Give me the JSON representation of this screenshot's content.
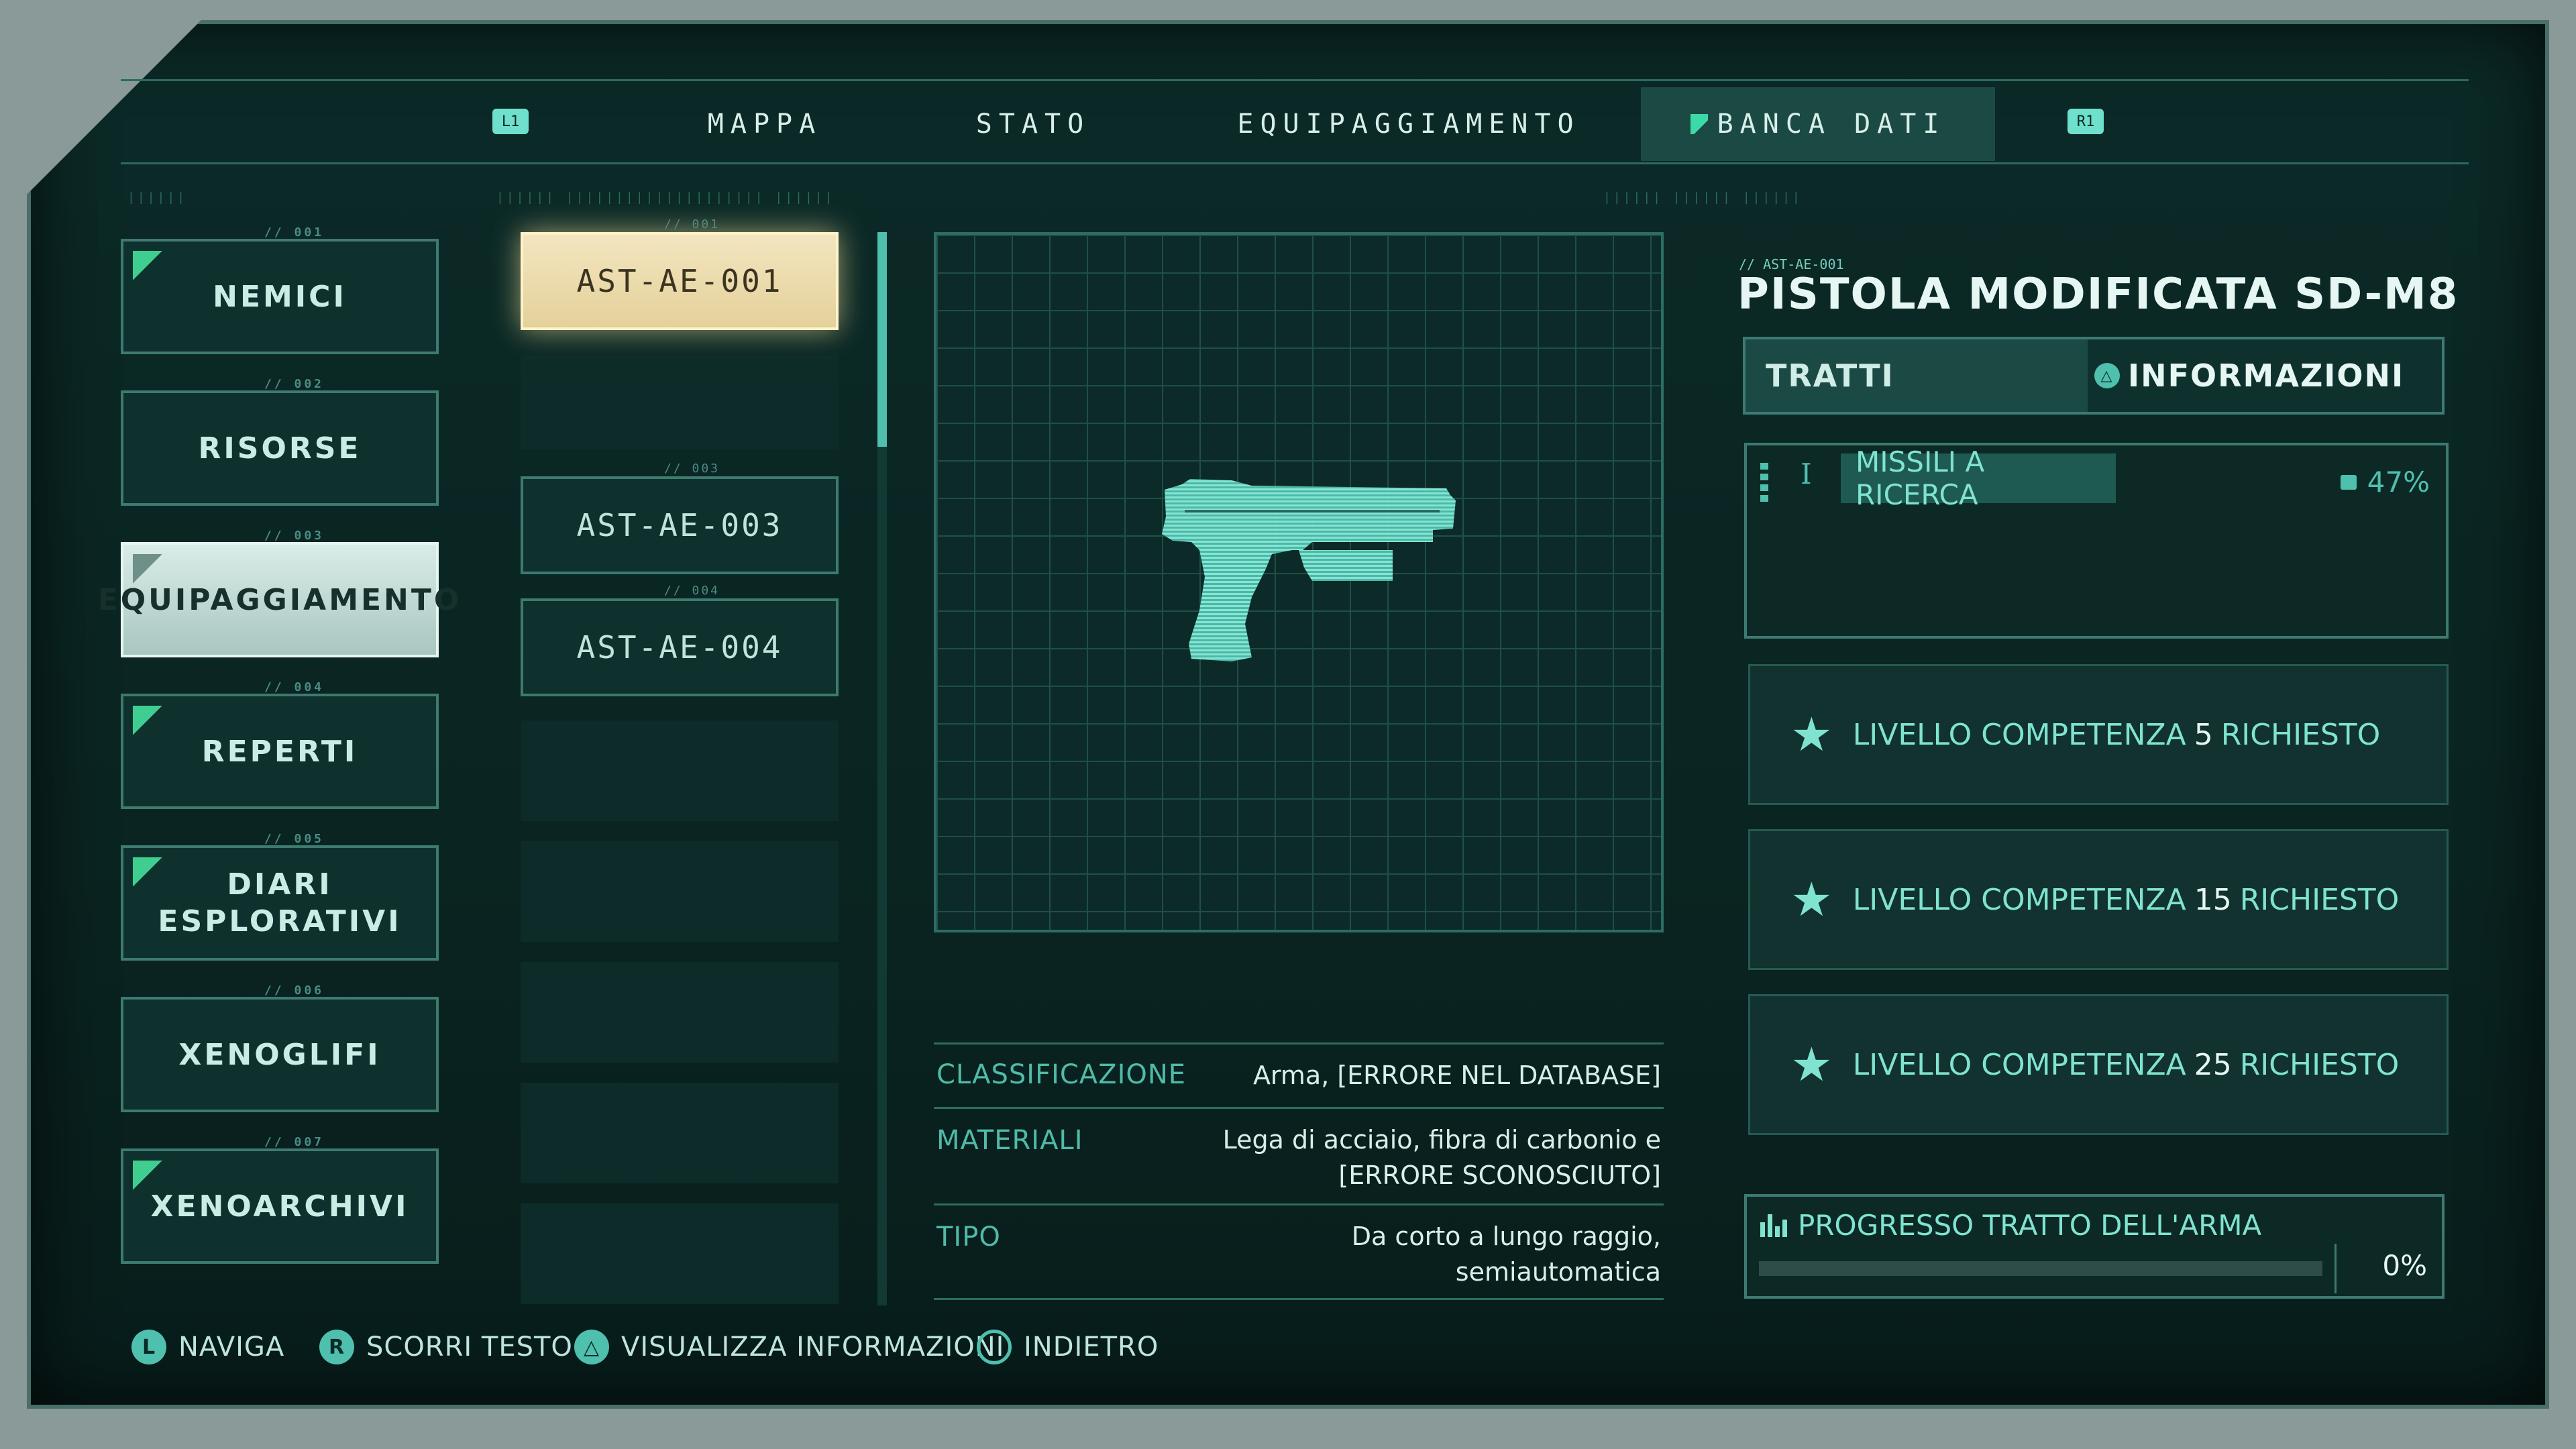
{
  "nav": {
    "left_key": "L1",
    "right_key": "R1",
    "tabs": [
      {
        "label": "MAPPA"
      },
      {
        "label": "STATO"
      },
      {
        "label": "EQUIPAGGIAMENTO"
      },
      {
        "label": "BANCA DATI"
      }
    ]
  },
  "categories": [
    {
      "num": "// 001",
      "label": "NEMICI"
    },
    {
      "num": "// 002",
      "label": "RISORSE"
    },
    {
      "num": "// 003",
      "label": "EQUIPAGGIAMENTO"
    },
    {
      "num": "// 004",
      "label": "REPERTI"
    },
    {
      "num": "// 005",
      "label": "DIARI\nESPLORATIVI"
    },
    {
      "num": "// 006",
      "label": "XENOGLIFI"
    },
    {
      "num": "// 007",
      "label": "XENOARCHIVI"
    }
  ],
  "entries": [
    {
      "num": "// 001",
      "label": "AST-AE-001"
    },
    {
      "num": "// 003",
      "label": "AST-AE-003"
    },
    {
      "num": "// 004",
      "label": "AST-AE-004"
    }
  ],
  "details": {
    "rows": [
      {
        "label": "CLASSIFICAZIONE",
        "value": "Arma, [ERRORE NEL DATABASE]"
      },
      {
        "label": "MATERIALI",
        "value": "Lega di acciaio, fibra di carbonio e\n[ERRORE SCONOSCIUTO]"
      },
      {
        "label": "TIPO",
        "value": "Da corto a lungo raggio,\nsemiautomatica"
      }
    ]
  },
  "item": {
    "code": "// AST-AE-001",
    "title": "PISTOLA MODIFICATA SD-M8",
    "tab_traits": "TRATTI",
    "tab_info": "INFORMAZIONI",
    "trait_roman": "I",
    "trait_name": "MISSILI A RICERCA",
    "trait_percent": "47%",
    "requirements": [
      {
        "prefix": "LIVELLO COMPETENZA",
        "level": "5",
        "suffix": "RICHIESTO"
      },
      {
        "prefix": "LIVELLO COMPETENZA",
        "level": "15",
        "suffix": "RICHIESTO"
      },
      {
        "prefix": "LIVELLO COMPETENZA",
        "level": "25",
        "suffix": "RICHIESTO"
      }
    ],
    "progress_label": "PROGRESSO TRATTO DELL'ARMA",
    "progress_value": "0%",
    "progress_fraction": 0
  },
  "footer": {
    "hints": [
      {
        "key": "L",
        "label": "NAVIGA"
      },
      {
        "key": "R",
        "label": "SCORRI TESTO"
      },
      {
        "key": "△",
        "label": "VISUALIZZA INFORMAZIONI"
      },
      {
        "key": "",
        "label": "INDIETRO"
      }
    ]
  },
  "colors": {
    "accent": "#7fe3cf",
    "background": "#0b2a27",
    "active_entry": "#f3e5bf"
  }
}
